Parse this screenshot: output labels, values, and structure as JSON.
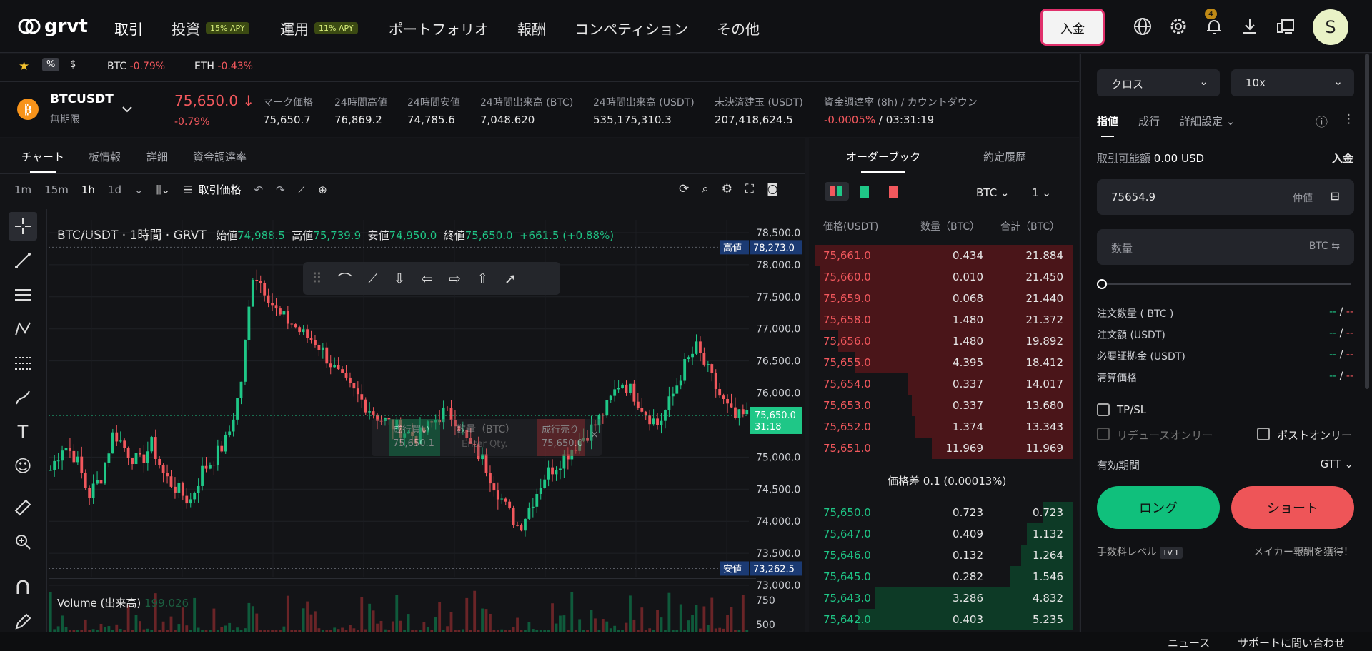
{
  "nav": {
    "brand": "grvt",
    "items": [
      {
        "label": "取引"
      },
      {
        "label": "投資",
        "badge": "15% APY"
      },
      {
        "label": "運用",
        "badge": "11% APY"
      },
      {
        "label": "ポートフォリオ"
      },
      {
        "label": "報酬"
      },
      {
        "label": "コンペティション"
      },
      {
        "label": "その他"
      }
    ],
    "deposit": "入金",
    "notif_count": "4",
    "avatar": "S"
  },
  "fav": {
    "pct": "%",
    "usd": "$",
    "btc_sym": "BTC",
    "btc_chg": "-0.79%",
    "eth_sym": "ETH",
    "eth_chg": "-0.43%"
  },
  "ticker": {
    "symbol": "BTCUSDT",
    "type": "無期限",
    "price": "75,650.0",
    "change": "-0.79%",
    "stats": [
      {
        "label": "マーク価格",
        "value": "75,650.7"
      },
      {
        "label": "24時間高値",
        "value": "76,869.2"
      },
      {
        "label": "24時間安値",
        "value": "74,785.6"
      },
      {
        "label": "24時間出来高 (BTC)",
        "value": "7,048.620"
      },
      {
        "label": "24時間出来高 (USDT)",
        "value": "535,175,310.3"
      },
      {
        "label": "未決済建玉 (USDT)",
        "value": "207,418,624.5"
      }
    ],
    "funding_label": "資金調達率 (8h) / カウントダウン",
    "funding_rate": "-0.0005%",
    "countdown": " / 03:31:19"
  },
  "chart_tabs": [
    "チャート",
    "板情報",
    "詳細",
    "資金調達率"
  ],
  "intervals": [
    "1m",
    "15m",
    "1h",
    "1d"
  ],
  "chart_toolbar": {
    "price_type": "取引価格"
  },
  "chart": {
    "legend": "BTC/USDT · 1時間 · GRVT",
    "o_label": "始値",
    "o": "74,988.5",
    "h_label": "高値",
    "h": "75,739.9",
    "l_label": "安値",
    "l": "74,950.0",
    "c_label": "終値",
    "c": "75,650.0",
    "chg": "+661.5 (+0.88%)",
    "high_tag": "高値",
    "high_val": "78,273.0",
    "low_tag": "安値",
    "low_val": "73,262.5",
    "cur_price": "75,650.0",
    "cur_time": "31:18",
    "volume_label": "Volume (出来高)",
    "volume_val": "199.026",
    "yticks": [
      "78,500.0",
      "78,000.0",
      "77,500.0",
      "77,000.0",
      "76,500.0",
      "76,000.0",
      "75,500.0",
      "75,000.0",
      "74,500.0",
      "74,000.0",
      "73,500.0",
      "73,000.0"
    ],
    "vol_ticks": [
      "750",
      "500"
    ],
    "overlay": {
      "market": "成行買い",
      "market_price": "75,650.1",
      "qty": "数量（BTC）",
      "qty_ph": "Enter Qty.",
      "sell": "成行売り",
      "sell_price": "75,650.0"
    }
  },
  "chart_data": {
    "type": "candlestick",
    "title": "BTC/USDT · 1時間 · GRVT",
    "y_range": [
      72800,
      78700
    ],
    "ylabel": "",
    "last_close": 75650.0,
    "high_marker": 78273.0,
    "low_marker": 73262.5
  },
  "orderbook": {
    "tabs": [
      "オーダーブック",
      "約定履歴"
    ],
    "asset": "BTC",
    "step": "1",
    "headers": [
      "価格(USDT)",
      "数量（BTC）",
      "合計（BTC）"
    ],
    "asks": [
      [
        "75,661.0",
        "0.434",
        "21.884"
      ],
      [
        "75,660.0",
        "0.010",
        "21.450"
      ],
      [
        "75,659.0",
        "0.068",
        "21.440"
      ],
      [
        "75,658.0",
        "1.480",
        "21.372"
      ],
      [
        "75,656.0",
        "1.480",
        "19.892"
      ],
      [
        "75,655.0",
        "4.395",
        "18.412"
      ],
      [
        "75,654.0",
        "0.337",
        "14.017"
      ],
      [
        "75,653.0",
        "0.337",
        "13.680"
      ],
      [
        "75,652.0",
        "1.374",
        "13.343"
      ],
      [
        "75,651.0",
        "11.969",
        "11.969"
      ]
    ],
    "spread_label": "価格差",
    "spread": "0.1 (0.00013%)",
    "bids": [
      [
        "75,650.0",
        "0.723",
        "0.723"
      ],
      [
        "75,647.0",
        "0.409",
        "1.132"
      ],
      [
        "75,646.0",
        "0.132",
        "1.264"
      ],
      [
        "75,645.0",
        "0.282",
        "1.546"
      ],
      [
        "75,643.0",
        "3.286",
        "4.832"
      ],
      [
        "75,642.0",
        "0.403",
        "5.235"
      ]
    ]
  },
  "order": {
    "margin": "クロス",
    "leverage": "10x",
    "tabs": [
      "指値",
      "成行",
      "詳細設定"
    ],
    "available_label": "取引可能額",
    "available": "0.00 USD",
    "deposit": "入金",
    "price": "75654.9",
    "mid": "仲値",
    "qty_ph": "数量",
    "qty_unit": "BTC",
    "rows": [
      {
        "label": "注文数量 ( BTC )",
        "a": "--",
        "b": "--"
      },
      {
        "label": "注文額 (USDT)",
        "a": "--",
        "b": "--"
      },
      {
        "label": "必要証拠金 (USDT)",
        "a": "--",
        "b": "--"
      },
      {
        "label": "清算価格",
        "a": "--",
        "b": "--"
      }
    ],
    "tpsl": "TP/SL",
    "reduce": "リデュースオンリー",
    "post": "ポストオンリー",
    "tif_label": "有効期間",
    "tif": "GTT",
    "long": "ロング",
    "short": "ショート",
    "fee_label": "手数料レベル",
    "fee_level": "LV.1",
    "maker": "メイカー報酬を獲得！"
  },
  "status": {
    "news": "ニュース",
    "support": "サポートに問い合わせ"
  }
}
